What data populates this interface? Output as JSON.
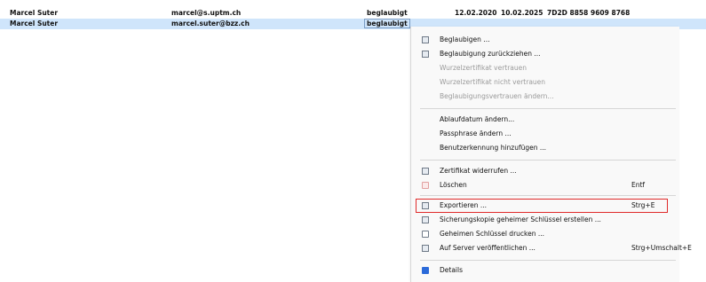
{
  "rows": [
    {
      "name": "Marcel Suter",
      "email": "marcel@s.uptm.ch",
      "validity": "beglaubigt",
      "valid_from": "12.02.2020",
      "valid_to": "10.02.2025",
      "fingerprint": "7D2D 8858 9609 8768"
    },
    {
      "name": "Marcel Suter",
      "email": "marcel.suter@bzz.ch",
      "validity": "beglaubigt"
    }
  ],
  "menu": {
    "certify": "Beglaubigen ...",
    "revoke_cert": "Beglaubigung zurückziehen ...",
    "trust_root": "Wurzelzertifikat vertrauen",
    "distrust_root": "Wurzelzertifikat nicht vertrauen",
    "change_trust": "Beglaubigungsvertrauen ändern...",
    "change_expiry": "Ablaufdatum ändern...",
    "change_passphrase": "Passphrase ändern ...",
    "add_userid": "Benutzerkennung hinzufügen ...",
    "revoke": "Zertifikat widerrufen ...",
    "delete": "Löschen",
    "delete_shortcut": "Entf",
    "export": "Exportieren ...",
    "export_shortcut": "Strg+E",
    "backup": "Sicherungskopie geheimer Schlüssel erstellen ...",
    "print_secret": "Geheimen Schlüssel drucken ...",
    "publish": "Auf Server veröffentlichen ...",
    "publish_shortcut": "Strg+Umschalt+E",
    "details": "Details"
  },
  "colors": {
    "selection": "#cfe5fb",
    "highlight": "#e02b2b",
    "details_icon": "#2b6ad9"
  }
}
